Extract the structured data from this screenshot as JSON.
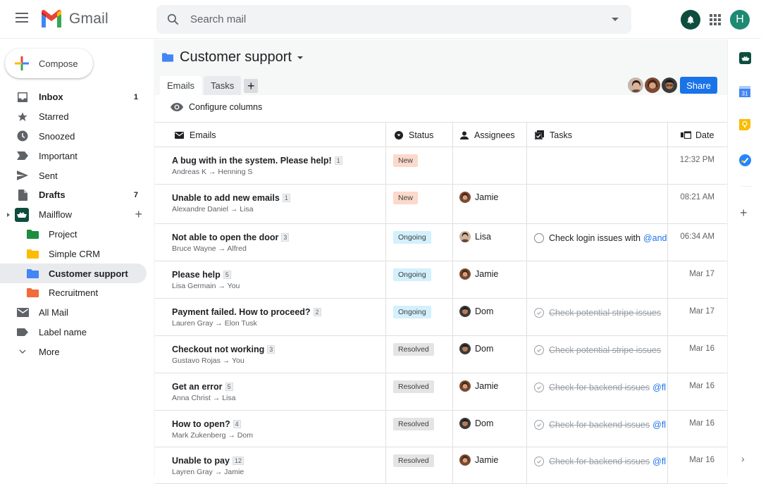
{
  "app": {
    "name": "Gmail"
  },
  "search": {
    "placeholder": "Search mail",
    "value": ""
  },
  "header": {
    "avatar_initial": "H"
  },
  "compose": {
    "label": "Compose"
  },
  "sidebar": {
    "items": [
      {
        "label": "Inbox",
        "count": "1",
        "icon": "inbox-icon",
        "bold": true
      },
      {
        "label": "Starred",
        "count": "",
        "icon": "star-icon"
      },
      {
        "label": "Snoozed",
        "count": "",
        "icon": "clock-icon"
      },
      {
        "label": "Important",
        "count": "",
        "icon": "important-icon"
      },
      {
        "label": "Sent",
        "count": "",
        "icon": "send-icon"
      },
      {
        "label": "Drafts",
        "count": "7",
        "icon": "draft-icon",
        "bold": true
      },
      {
        "label": "Mailflow",
        "count": "",
        "icon": "mailflow-icon"
      },
      {
        "label": "Project",
        "icon": "folder-icon",
        "color": "#1e8e3e"
      },
      {
        "label": "Simple CRM",
        "icon": "folder-icon",
        "color": "#fbbc04"
      },
      {
        "label": "Customer support",
        "icon": "folder-icon",
        "color": "#4285f4",
        "active": true
      },
      {
        "label": "Recruitment",
        "icon": "folder-icon",
        "color": "#f26b3a"
      },
      {
        "label": "All Mail",
        "icon": "mail-icon"
      },
      {
        "label": "Label name",
        "icon": "label-icon"
      },
      {
        "label": "More",
        "icon": "chevron-down-icon"
      }
    ]
  },
  "main": {
    "title": "Customer support",
    "tabs": [
      {
        "label": "Emails",
        "active": true
      },
      {
        "label": "Tasks",
        "active": false
      }
    ],
    "share_label": "Share",
    "configure_label": "Configure columns",
    "columns": {
      "emails": "Emails",
      "status": "Status",
      "assignees": "Assignees",
      "tasks": "Tasks",
      "date": "Date"
    }
  },
  "status_colors": {
    "New": "#fcd9cb",
    "Ongoing": "#d3f0fc",
    "Resolved": "#e4e4e4"
  },
  "rows": [
    {
      "subject": "A bug with in the system. Please help!",
      "count": "1",
      "from": "Andreas K → Henning S",
      "status": "New",
      "assignee": "",
      "task": "",
      "task_done": false,
      "mention": "",
      "date": "12:32 PM"
    },
    {
      "subject": "Unable to add new emails",
      "count": "1",
      "from": "Alexandre Daniel → Lisa",
      "status": "New",
      "assignee": "Jamie",
      "task": "",
      "task_done": false,
      "mention": "",
      "date": "08:21 AM"
    },
    {
      "subject": "Not able to open the door",
      "count": "3",
      "from": "Bruce Wayne → Alfred",
      "status": "Ongoing",
      "assignee": "Lisa",
      "task": "Check login issues with",
      "task_done": false,
      "mention": "@and",
      "date": "06:34 AM"
    },
    {
      "subject": "Please help",
      "count": "5",
      "from": "Lisa Germain → You",
      "status": "Ongoing",
      "assignee": "Jamie",
      "task": "",
      "task_done": false,
      "mention": "",
      "date": "Mar 17"
    },
    {
      "subject": "Payment failed. How to proceed?",
      "count": "2",
      "from": "Lauren Gray → Elon Tusk",
      "status": "Ongoing",
      "assignee": "Dom",
      "task": "Check potential stripe issues",
      "task_done": true,
      "mention": "",
      "date": "Mar 17"
    },
    {
      "subject": "Checkout not working",
      "count": "3",
      "from": "Gustavo Rojas → You",
      "status": "Resolved",
      "assignee": "Dom",
      "task": "Check potential stripe issues",
      "task_done": true,
      "mention": "",
      "date": "Mar 16"
    },
    {
      "subject": "Get an error",
      "count": "5",
      "from": "Anna Christ → Lisa",
      "status": "Resolved",
      "assignee": "Jamie",
      "task": "Check for backend issues",
      "task_done": true,
      "mention": "@fl",
      "date": "Mar 16"
    },
    {
      "subject": "How to open?",
      "count": "4",
      "from": "Mark Zukenberg → Dom",
      "status": "Resolved",
      "assignee": "Dom",
      "task": "Check for backend issues",
      "task_done": true,
      "mention": "@fl",
      "date": "Mar 16"
    },
    {
      "subject": "Unable to pay",
      "count": "12",
      "from": "Layren Gray → Jamie",
      "status": "Resolved",
      "assignee": "Jamie",
      "task": "Check for backend issues",
      "task_done": true,
      "mention": "@fl",
      "date": "Mar 16"
    }
  ]
}
